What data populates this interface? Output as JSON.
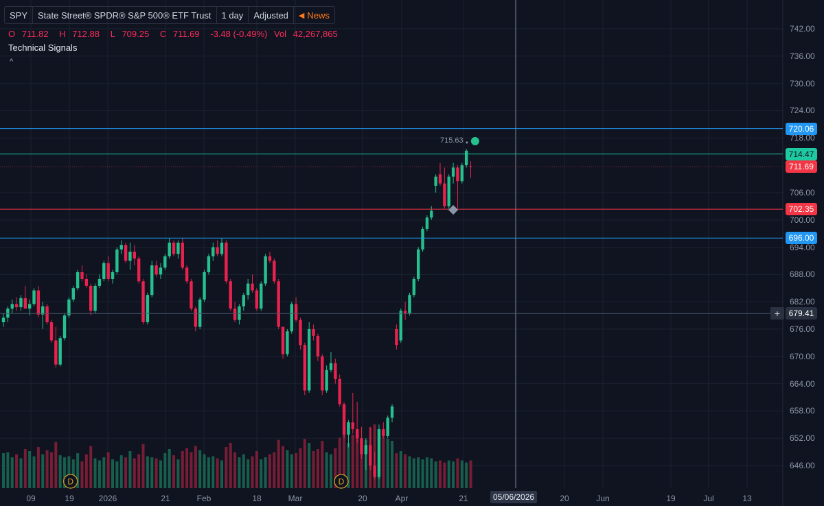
{
  "header": {
    "symbol": "SPY",
    "name": "State Street® SPDR® S&P 500® ETF Trust",
    "interval": "1 day",
    "adjustment": "Adjusted",
    "news_label": "News"
  },
  "ohlc": {
    "open_label": "O",
    "open": "711.82",
    "high_label": "H",
    "high": "712.88",
    "low_label": "L",
    "low": "709.25",
    "close_label": "C",
    "close": "711.69",
    "change": "-3.48 (-0.49%)",
    "vol_label": "Vol",
    "volume": "42,267,865"
  },
  "panel": {
    "title": "Technical Signals",
    "collapse_icon": "^"
  },
  "colors": {
    "background": "#0f1420",
    "up": "#26c08e",
    "down": "#e8224e",
    "blue_line": "#2196f3",
    "teal_line": "#1ec8a0",
    "red_line": "#f23645",
    "grid": "#1b2230"
  },
  "price_tags": [
    {
      "price": 720.06,
      "label": "720.06",
      "color": "#2196f3",
      "line": true
    },
    {
      "price": 714.47,
      "label": "714.47",
      "color": "#1ec8a0",
      "line": true
    },
    {
      "price": 711.69,
      "label": "711.69",
      "color": "#f23645",
      "line": false
    },
    {
      "price": 702.35,
      "label": "702.35",
      "color": "#f23645",
      "line": true
    },
    {
      "price": 696.0,
      "label": "696.00",
      "color": "#2196f3",
      "line": true
    },
    {
      "price": 679.41,
      "label": "679.41",
      "color": "#2a3140",
      "line": true
    }
  ],
  "marker_label": "715.63",
  "crosshair_date": "05/06/2026",
  "dividend_marker": "D",
  "chart_data": {
    "type": "candlestick",
    "y_axis_ticks": [
      "742.00",
      "736.00",
      "730.00",
      "724.00",
      "718.00",
      "706.00",
      "700.00",
      "694.00",
      "688.00",
      "682.00",
      "676.00",
      "670.00",
      "664.00",
      "658.00",
      "652.00",
      "646.00"
    ],
    "y_range": [
      642,
      745
    ],
    "x_axis_ticks": [
      "09",
      "19",
      "2026",
      "21",
      "Feb",
      "18",
      "Mar",
      "20",
      "Apr",
      "21",
      "20",
      "Jun",
      "19",
      "Jul",
      "13"
    ],
    "candles": [
      {
        "o": 677.5,
        "h": 679.5,
        "l": 676.5,
        "c": 678.5
      },
      {
        "o": 678.5,
        "h": 681.0,
        "l": 677.5,
        "c": 680.5
      },
      {
        "o": 680.5,
        "h": 682.5,
        "l": 679.5,
        "c": 681.5
      },
      {
        "o": 681.5,
        "h": 683.0,
        "l": 680.0,
        "c": 680.8
      },
      {
        "o": 680.8,
        "h": 683.5,
        "l": 680.0,
        "c": 682.8
      },
      {
        "o": 682.8,
        "h": 685.5,
        "l": 681.5,
        "c": 680.5
      },
      {
        "o": 680.5,
        "h": 682.5,
        "l": 679.0,
        "c": 681.5
      },
      {
        "o": 681.5,
        "h": 685.0,
        "l": 681.0,
        "c": 684.5
      },
      {
        "o": 684.5,
        "h": 685.5,
        "l": 678.5,
        "c": 679.2
      },
      {
        "o": 679.2,
        "h": 682.0,
        "l": 676.0,
        "c": 681.0
      },
      {
        "o": 681.0,
        "h": 681.5,
        "l": 677.0,
        "c": 677.5
      },
      {
        "o": 677.5,
        "h": 678.0,
        "l": 673.0,
        "c": 673.5
      },
      {
        "o": 673.5,
        "h": 676.5,
        "l": 667.5,
        "c": 668.2
      },
      {
        "o": 668.2,
        "h": 674.5,
        "l": 667.8,
        "c": 674.0
      },
      {
        "o": 674.0,
        "h": 679.5,
        "l": 673.5,
        "c": 679.0
      },
      {
        "o": 679.0,
        "h": 683.0,
        "l": 678.5,
        "c": 682.5
      },
      {
        "o": 682.5,
        "h": 685.5,
        "l": 682.0,
        "c": 685.0
      },
      {
        "o": 685.0,
        "h": 689.0,
        "l": 684.5,
        "c": 688.5
      },
      {
        "o": 688.5,
        "h": 690.0,
        "l": 686.5,
        "c": 687.0
      },
      {
        "o": 687.0,
        "h": 688.0,
        "l": 685.0,
        "c": 685.5
      },
      {
        "o": 685.5,
        "h": 686.0,
        "l": 679.0,
        "c": 680.0
      },
      {
        "o": 680.0,
        "h": 686.0,
        "l": 679.5,
        "c": 685.5
      },
      {
        "o": 685.5,
        "h": 688.0,
        "l": 685.0,
        "c": 687.0
      },
      {
        "o": 687.0,
        "h": 691.0,
        "l": 686.5,
        "c": 690.5
      },
      {
        "o": 690.5,
        "h": 692.0,
        "l": 686.5,
        "c": 687.0
      },
      {
        "o": 687.0,
        "h": 689.0,
        "l": 686.0,
        "c": 688.5
      },
      {
        "o": 688.5,
        "h": 694.0,
        "l": 688.0,
        "c": 693.5
      },
      {
        "o": 693.5,
        "h": 695.5,
        "l": 692.5,
        "c": 694.5
      },
      {
        "o": 694.5,
        "h": 695.0,
        "l": 690.5,
        "c": 691.0
      },
      {
        "o": 691.0,
        "h": 695.0,
        "l": 689.0,
        "c": 693.0
      },
      {
        "o": 693.0,
        "h": 694.5,
        "l": 690.0,
        "c": 691.5
      },
      {
        "o": 691.5,
        "h": 692.0,
        "l": 686.0,
        "c": 686.5
      },
      {
        "o": 686.5,
        "h": 687.0,
        "l": 677.0,
        "c": 677.5
      },
      {
        "o": 677.5,
        "h": 684.0,
        "l": 677.0,
        "c": 683.5
      },
      {
        "o": 683.5,
        "h": 691.0,
        "l": 683.0,
        "c": 690.0
      },
      {
        "o": 690.0,
        "h": 691.0,
        "l": 687.5,
        "c": 688.0
      },
      {
        "o": 688.0,
        "h": 690.5,
        "l": 687.0,
        "c": 689.5
      },
      {
        "o": 689.5,
        "h": 692.5,
        "l": 689.0,
        "c": 692.0
      },
      {
        "o": 692.0,
        "h": 696.0,
        "l": 691.5,
        "c": 695.0
      },
      {
        "o": 695.0,
        "h": 695.5,
        "l": 692.0,
        "c": 692.5
      },
      {
        "o": 692.5,
        "h": 695.5,
        "l": 691.5,
        "c": 695.0
      },
      {
        "o": 695.0,
        "h": 696.0,
        "l": 689.0,
        "c": 689.5
      },
      {
        "o": 689.5,
        "h": 690.0,
        "l": 686.0,
        "c": 686.5
      },
      {
        "o": 686.5,
        "h": 687.0,
        "l": 680.0,
        "c": 680.5
      },
      {
        "o": 680.5,
        "h": 681.0,
        "l": 675.5,
        "c": 676.5
      },
      {
        "o": 676.5,
        "h": 683.0,
        "l": 676.0,
        "c": 682.5
      },
      {
        "o": 682.5,
        "h": 689.0,
        "l": 682.0,
        "c": 688.5
      },
      {
        "o": 688.5,
        "h": 692.5,
        "l": 688.0,
        "c": 692.0
      },
      {
        "o": 692.0,
        "h": 695.0,
        "l": 691.0,
        "c": 694.0
      },
      {
        "o": 694.0,
        "h": 695.5,
        "l": 692.0,
        "c": 692.5
      },
      {
        "o": 692.5,
        "h": 696.0,
        "l": 692.0,
        "c": 695.0
      },
      {
        "o": 695.0,
        "h": 695.5,
        "l": 686.0,
        "c": 686.5
      },
      {
        "o": 686.5,
        "h": 687.0,
        "l": 680.0,
        "c": 680.5
      },
      {
        "o": 680.5,
        "h": 682.0,
        "l": 677.5,
        "c": 678.0
      },
      {
        "o": 678.0,
        "h": 681.5,
        "l": 677.0,
        "c": 681.0
      },
      {
        "o": 681.0,
        "h": 684.0,
        "l": 680.0,
        "c": 683.5
      },
      {
        "o": 683.5,
        "h": 687.0,
        "l": 682.5,
        "c": 686.0
      },
      {
        "o": 686.0,
        "h": 688.0,
        "l": 684.0,
        "c": 684.5
      },
      {
        "o": 684.5,
        "h": 685.0,
        "l": 680.0,
        "c": 680.5
      },
      {
        "o": 680.5,
        "h": 686.5,
        "l": 680.0,
        "c": 686.0
      },
      {
        "o": 686.0,
        "h": 692.5,
        "l": 685.5,
        "c": 692.0
      },
      {
        "o": 692.0,
        "h": 693.0,
        "l": 690.5,
        "c": 691.0
      },
      {
        "o": 691.0,
        "h": 691.5,
        "l": 686.0,
        "c": 686.5
      },
      {
        "o": 686.5,
        "h": 687.0,
        "l": 676.0,
        "c": 676.5
      },
      {
        "o": 676.5,
        "h": 676.5,
        "l": 669.5,
        "c": 670.5
      },
      {
        "o": 670.5,
        "h": 676.0,
        "l": 670.0,
        "c": 675.5
      },
      {
        "o": 675.5,
        "h": 682.0,
        "l": 675.0,
        "c": 681.5
      },
      {
        "o": 681.5,
        "h": 683.0,
        "l": 677.5,
        "c": 678.0
      },
      {
        "o": 678.0,
        "h": 678.5,
        "l": 671.5,
        "c": 672.5
      },
      {
        "o": 672.5,
        "h": 673.0,
        "l": 661.5,
        "c": 662.5
      },
      {
        "o": 662.5,
        "h": 677.5,
        "l": 662.0,
        "c": 676.0
      },
      {
        "o": 676.0,
        "h": 677.0,
        "l": 673.5,
        "c": 674.5
      },
      {
        "o": 674.5,
        "h": 675.0,
        "l": 669.0,
        "c": 670.0
      },
      {
        "o": 670.0,
        "h": 670.5,
        "l": 661.5,
        "c": 662.5
      },
      {
        "o": 662.5,
        "h": 668.0,
        "l": 662.0,
        "c": 667.0
      },
      {
        "o": 667.0,
        "h": 671.0,
        "l": 666.5,
        "c": 668.5
      },
      {
        "o": 668.5,
        "h": 669.5,
        "l": 664.0,
        "c": 665.0
      },
      {
        "o": 665.0,
        "h": 666.0,
        "l": 659.0,
        "c": 659.5
      },
      {
        "o": 659.5,
        "h": 660.0,
        "l": 652.0,
        "c": 652.8
      },
      {
        "o": 652.8,
        "h": 656.0,
        "l": 650.0,
        "c": 655.5
      },
      {
        "o": 655.5,
        "h": 662.0,
        "l": 653.0,
        "c": 654.0
      },
      {
        "o": 654.0,
        "h": 660.0,
        "l": 651.0,
        "c": 652.0
      },
      {
        "o": 652.0,
        "h": 654.5,
        "l": 647.5,
        "c": 648.5
      },
      {
        "o": 648.5,
        "h": 652.0,
        "l": 645.0,
        "c": 650.5
      },
      {
        "o": 650.5,
        "h": 654.5,
        "l": 645.0,
        "c": 646.0
      },
      {
        "o": 646.0,
        "h": 649.0,
        "l": 643.0,
        "c": 643.5
      },
      {
        "o": 643.5,
        "h": 655.0,
        "l": 643.0,
        "c": 654.0
      },
      {
        "o": 654.0,
        "h": 655.5,
        "l": 652.0,
        "c": 652.5
      },
      {
        "o": 652.5,
        "h": 657.0,
        "l": 652.0,
        "c": 656.5
      },
      {
        "o": 656.5,
        "h": 659.5,
        "l": 655.5,
        "c": 659.0
      },
      {
        "o": 676.0,
        "h": 677.0,
        "l": 671.5,
        "c": 672.5
      },
      {
        "o": 673.5,
        "h": 680.5,
        "l": 673.0,
        "c": 680.0
      },
      {
        "o": 680.0,
        "h": 682.0,
        "l": 678.0,
        "c": 679.5
      },
      {
        "o": 679.5,
        "h": 684.0,
        "l": 679.0,
        "c": 683.5
      },
      {
        "o": 683.5,
        "h": 687.5,
        "l": 683.0,
        "c": 687.0
      },
      {
        "o": 687.0,
        "h": 694.0,
        "l": 686.5,
        "c": 693.5
      },
      {
        "o": 693.5,
        "h": 698.5,
        "l": 693.0,
        "c": 698.0
      },
      {
        "o": 698.0,
        "h": 701.0,
        "l": 697.5,
        "c": 700.5
      },
      {
        "o": 700.5,
        "h": 703.0,
        "l": 700.0,
        "c": 702.0
      },
      {
        "o": 707.5,
        "h": 710.0,
        "l": 706.0,
        "c": 709.5
      },
      {
        "o": 710.0,
        "h": 712.5,
        "l": 707.5,
        "c": 708.0
      },
      {
        "o": 708.0,
        "h": 711.5,
        "l": 702.5,
        "c": 703.0
      },
      {
        "o": 703.0,
        "h": 710.0,
        "l": 702.5,
        "c": 709.5
      },
      {
        "o": 709.5,
        "h": 712.5,
        "l": 708.0,
        "c": 711.5
      },
      {
        "o": 711.5,
        "h": 712.0,
        "l": 702.5,
        "c": 708.5
      },
      {
        "o": 708.5,
        "h": 712.5,
        "l": 708.0,
        "c": 712.0
      },
      {
        "o": 712.0,
        "h": 715.6,
        "l": 711.5,
        "c": 715.2
      },
      {
        "o": 711.82,
        "h": 712.88,
        "l": 709.25,
        "c": 711.69
      }
    ],
    "volumes": [
      34,
      35,
      30,
      33,
      29,
      38,
      36,
      31,
      40,
      33,
      37,
      35,
      45,
      32,
      30,
      31,
      28,
      34,
      26,
      33,
      41,
      29,
      27,
      30,
      35,
      28,
      26,
      32,
      30,
      36,
      29,
      33,
      43,
      31,
      30,
      29,
      27,
      34,
      38,
      32,
      28,
      36,
      39,
      35,
      41,
      37,
      33,
      30,
      31,
      29,
      27,
      40,
      44,
      35,
      30,
      33,
      28,
      31,
      36,
      28,
      30,
      33,
      35,
      47,
      41,
      37,
      33,
      34,
      39,
      48,
      44,
      36,
      38,
      46,
      35,
      33,
      39,
      49,
      57,
      44,
      52,
      54,
      48,
      47,
      59,
      62,
      51,
      50,
      48,
      46,
      34,
      36,
      33,
      31,
      29,
      30,
      28,
      30,
      29,
      26,
      27,
      25,
      27,
      26,
      29,
      27,
      25,
      27,
      23
    ],
    "markers": [
      {
        "type": "dividend",
        "label": "D",
        "candle_index": 13
      },
      {
        "type": "dividend",
        "label": "D",
        "candle_index": 75
      }
    ]
  }
}
